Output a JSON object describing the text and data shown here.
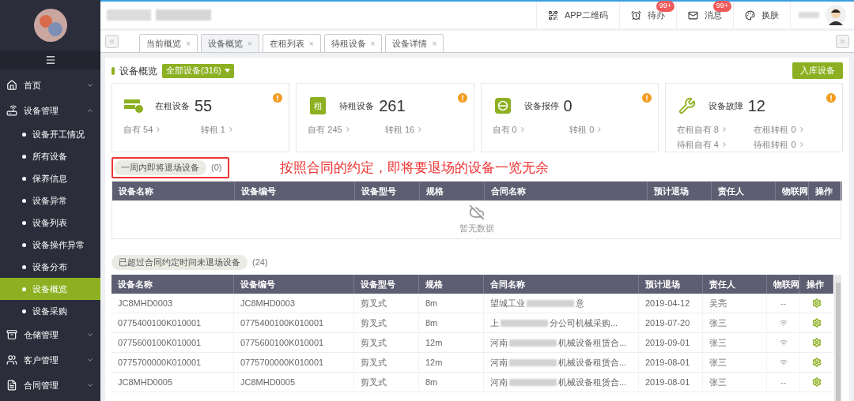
{
  "sidebar": {
    "items": [
      {
        "label": "首页",
        "expanded": false
      },
      {
        "label": "设备管理",
        "expanded": true,
        "children": [
          {
            "label": "设备开工情况",
            "selected": false
          },
          {
            "label": "所有设备",
            "selected": false
          },
          {
            "label": "保养信息",
            "selected": false
          },
          {
            "label": "设备异常",
            "selected": false
          },
          {
            "label": "设备列表",
            "selected": false
          },
          {
            "label": "设备操作异常",
            "selected": false
          },
          {
            "label": "设备分布",
            "selected": false
          },
          {
            "label": "设备概览",
            "selected": true
          },
          {
            "label": "设备采购",
            "selected": false
          }
        ]
      },
      {
        "label": "仓储管理",
        "expanded": false
      },
      {
        "label": "客户管理",
        "expanded": false
      },
      {
        "label": "合同管理",
        "expanded": false
      }
    ]
  },
  "header": {
    "items": [
      {
        "label": "APP二维码"
      },
      {
        "label": "待办",
        "badge": "99+"
      },
      {
        "label": "消息",
        "badge": "99+"
      },
      {
        "label": "换肤"
      }
    ]
  },
  "tabs": [
    {
      "label": "当前概览",
      "close": "×",
      "selected": false
    },
    {
      "label": "设备概览",
      "close": "×",
      "selected": true
    },
    {
      "label": "在租列表",
      "close": "×",
      "selected": false
    },
    {
      "label": "待租设备",
      "close": "×",
      "selected": false
    },
    {
      "label": "设备详情",
      "close": "×",
      "selected": false
    }
  ],
  "page": {
    "title": "设备概览",
    "filter": "全部设备(316)",
    "action": "入库设备"
  },
  "cards": [
    {
      "label": "在租设备",
      "value": "55",
      "stats": [
        "自有 54",
        "转租 1"
      ]
    },
    {
      "icon_text": "租",
      "label": "待租设备",
      "value": "261",
      "stats": [
        "自有 245",
        "转租 16"
      ]
    },
    {
      "label": "设备报停",
      "value": "0",
      "stats": [
        "自有 0",
        "转租 0"
      ]
    },
    {
      "label": "设备故障",
      "value": "12",
      "stats": [
        "在租自有 8",
        "在租转租 0",
        "待租自有 4",
        "待租转租 0"
      ]
    }
  ],
  "upcoming": {
    "label": "一周内即将退场设备",
    "count": "(0)",
    "annotation": "按照合同的约定，即将要退场的设备一览无余",
    "columns": [
      "设备名称",
      "设备编号",
      "设备型号",
      "规格",
      "合同名称",
      "预计退场",
      "责任人",
      "物联网",
      "操作"
    ],
    "empty_text": "暂无数据"
  },
  "overdue": {
    "label": "已超过合同约定时间未退场设备",
    "count": "(24)",
    "columns": [
      "设备名称",
      "设备编号",
      "设备型号",
      "规格",
      "合同名称",
      "预计退场",
      "责任人",
      "物联网",
      "操作"
    ],
    "rows": [
      {
        "name": "JC8MHD0003",
        "code": "JC8MHD0003",
        "model": "剪叉式",
        "spec": "8m",
        "contract_prefix": "望城工业",
        "contract_suffix": "意",
        "date": "2019-04-12",
        "person": "吴亮",
        "iot": {
          "kind": "dash",
          "text": "--"
        }
      },
      {
        "name": "0775400100K010001",
        "code": "0775400100K010001",
        "model": "剪叉式",
        "spec": "8m",
        "contract_prefix": "上",
        "contract_suffix": "分公司机械采购...",
        "date": "2019-07-20",
        "person": "张三",
        "iot": {
          "kind": "signal"
        }
      },
      {
        "name": "0775600100K010001",
        "code": "0775600100K010001",
        "model": "剪叉式",
        "spec": "12m",
        "contract_prefix": "河南",
        "contract_suffix": "机械设备租赁合...",
        "date": "2019-09-01",
        "person": "张三",
        "iot": {
          "kind": "signal"
        }
      },
      {
        "name": "0775700000K010001",
        "code": "0775700000K010001",
        "model": "剪叉式",
        "spec": "12m",
        "contract_prefix": "河南",
        "contract_suffix": "机械设备租赁合...",
        "date": "2019-08-01",
        "person": "张三",
        "iot": {
          "kind": "signal"
        }
      },
      {
        "name": "JC8MHD0005",
        "code": "JC8MHD0005",
        "model": "剪叉式",
        "spec": "8m",
        "contract_prefix": "河南",
        "contract_suffix": "机械设备租赁合...",
        "date": "2019-08-01",
        "person": "张三",
        "iot": {
          "kind": "dash",
          "text": "--"
        }
      }
    ]
  }
}
